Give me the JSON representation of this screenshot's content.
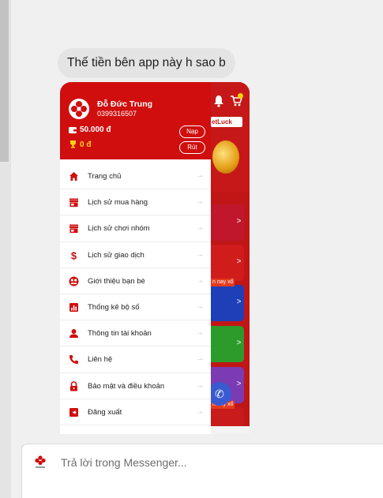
{
  "message": {
    "text": "Thế tiền bên app này h sao b"
  },
  "drawer": {
    "user_name": "Đỗ Đức Trung",
    "phone": "0399316507",
    "balance": "50.000 đ",
    "points": "0 đ",
    "deposit_label": "Nạp",
    "withdraw_label": "Rút",
    "items": [
      {
        "label": "Trang chủ",
        "icon": "home-icon"
      },
      {
        "label": "Lịch sử mua hàng",
        "icon": "store-icon"
      },
      {
        "label": "Lịch sử chơi nhóm",
        "icon": "store-icon"
      },
      {
        "label": "Lịch sử giao dịch",
        "icon": "dollar-icon"
      },
      {
        "label": "Giới thiệu bạn bè",
        "icon": "referral-icon"
      },
      {
        "label": "Thống kê bộ số",
        "icon": "bar-chart-icon"
      },
      {
        "label": "Thông tin tài khoản",
        "icon": "person-icon"
      },
      {
        "label": "Liên hệ",
        "icon": "phone-icon"
      },
      {
        "label": "Bảo mật và điều khoản",
        "icon": "lock-icon"
      },
      {
        "label": "Đăng xuất",
        "icon": "logout-icon"
      }
    ]
  },
  "background_app": {
    "logo_text": "etLuck",
    "card_tag": "n nay xổ"
  },
  "reply": {
    "placeholder": "Trả lời trong Messenger..."
  },
  "colors": {
    "brand_red": "#d00e0e",
    "points_yellow": "#ffd21a"
  }
}
